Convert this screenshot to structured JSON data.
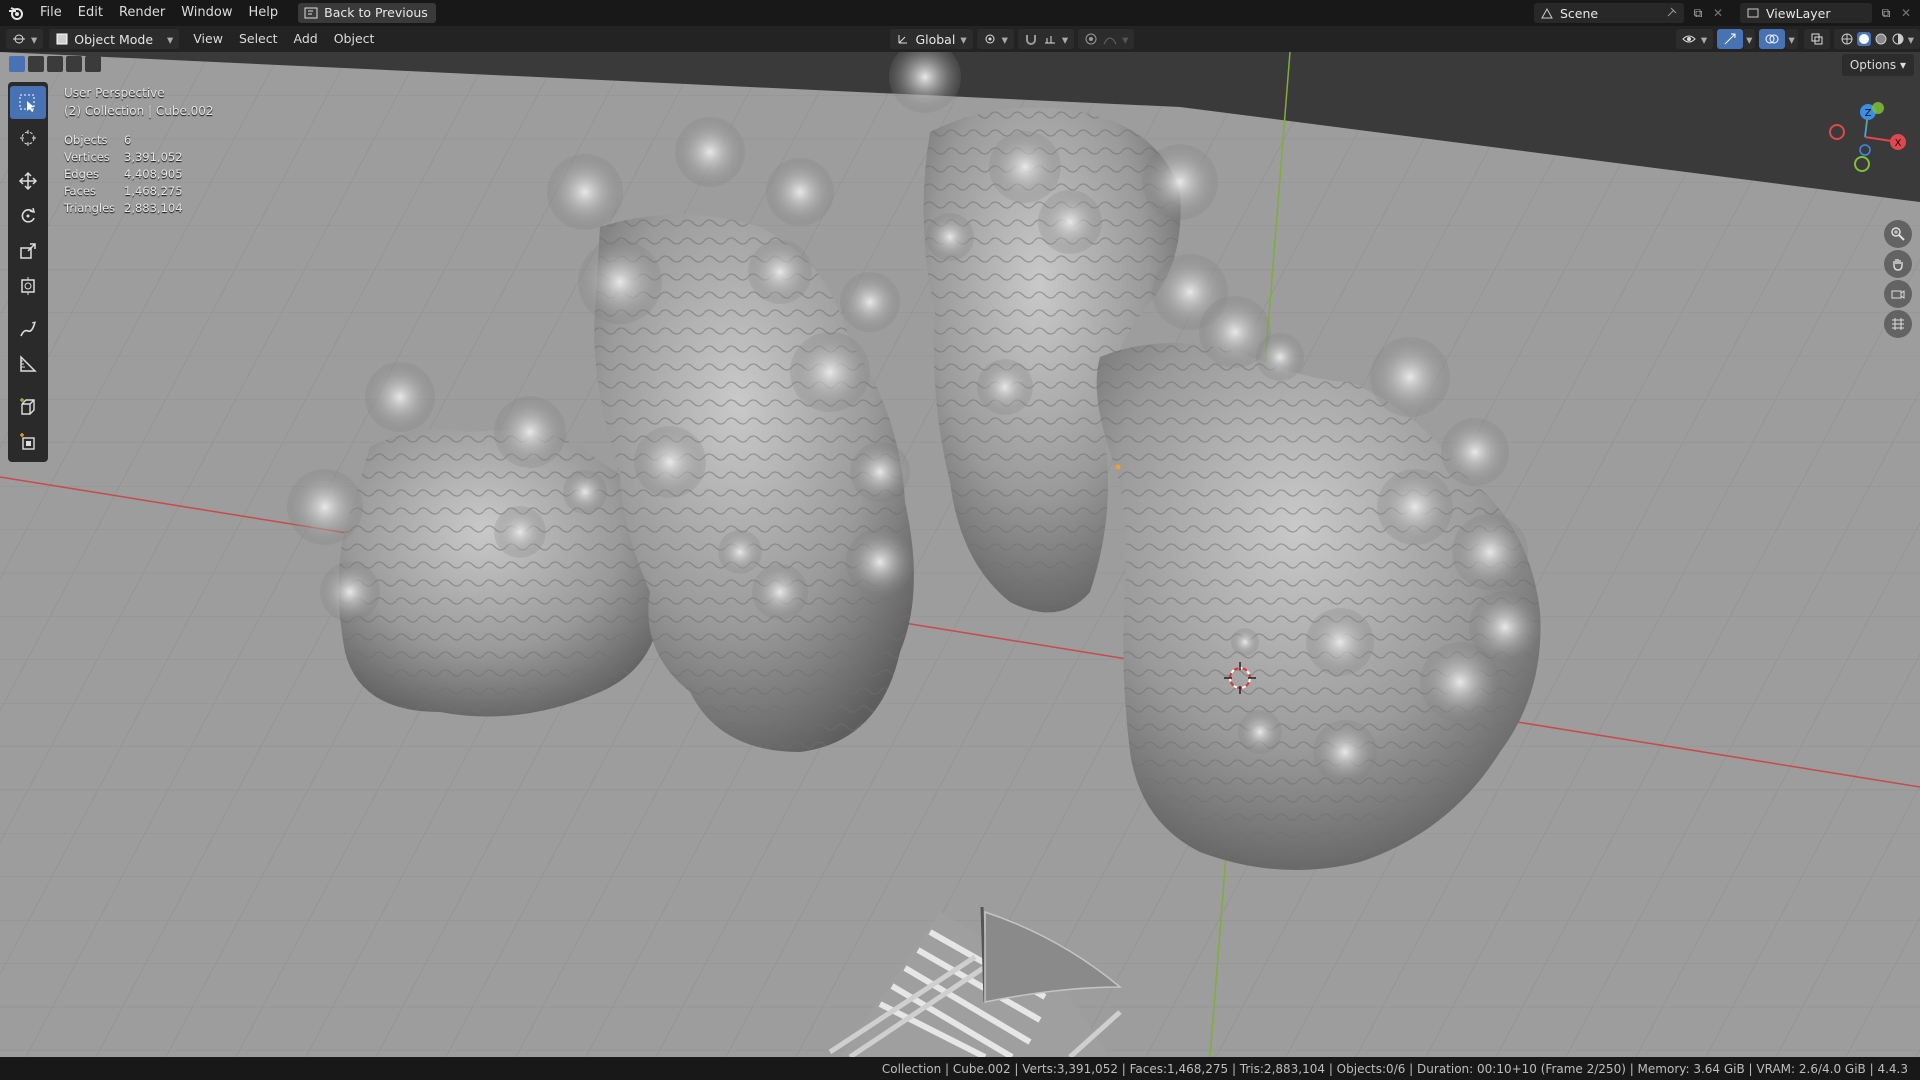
{
  "topbar": {
    "menus": [
      "File",
      "Edit",
      "Render",
      "Window",
      "Help"
    ],
    "back_button": "Back to Previous",
    "scene_field": "Scene",
    "view_layer_field": "ViewLayer"
  },
  "header": {
    "mode": "Object Mode",
    "menus": [
      "View",
      "Select",
      "Add",
      "Object"
    ],
    "transform_orientation": "Global",
    "options": "Options"
  },
  "viewport": {
    "perspective_label": "User Perspective",
    "collection_label": "(2) Collection | Cube.002",
    "stats": [
      {
        "k": "Objects",
        "v": "6"
      },
      {
        "k": "Vertices",
        "v": "3,391,052"
      },
      {
        "k": "Edges",
        "v": "4,408,905"
      },
      {
        "k": "Faces",
        "v": "1,468,275"
      },
      {
        "k": "Triangles",
        "v": "2,883,104"
      }
    ],
    "gizmo_axes": {
      "x": "X",
      "y": "Y",
      "z": "Z"
    }
  },
  "statusbar": {
    "text": "Collection | Cube.002 | Verts:3,391,052 | Faces:1,468,275 | Tris:2,883,104 | Objects:0/6 | Duration: 00:10+10 (Frame 2/250) | Memory: 3.64 GiB | VRAM: 2.6/4.0 GiB | 4.4.3"
  },
  "colors": {
    "accent": "#4772b3",
    "axis_x": "#e0474f",
    "axis_y": "#7fbf3a",
    "axis_z": "#3a8ee6",
    "viewport_bg": "#3d3d3d",
    "grid_floor": "#7a7a7a"
  },
  "icons": {
    "app_logo": "blender-logo-icon",
    "tools": [
      "select-box-icon",
      "cursor-icon",
      "move-icon",
      "rotate-icon",
      "scale-icon",
      "transform-icon",
      "annotate-icon",
      "measure-icon",
      "add-cube-icon",
      "add-object-icon"
    ],
    "nav": [
      "zoom-icon",
      "pan-hand-icon",
      "camera-icon",
      "grid-view-icon"
    ]
  }
}
